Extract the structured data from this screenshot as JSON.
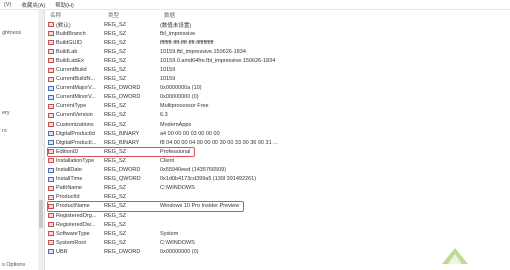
{
  "menubar": {
    "items": [
      "(V)",
      "收藏夹(A)",
      "帮助(H)"
    ]
  },
  "left_pane": {
    "labels": [
      {
        "text": "ghtness"
      },
      {
        "text": "ery"
      },
      {
        "text": "rs"
      },
      {
        "text": "s Options"
      }
    ]
  },
  "header": {
    "name": "名称",
    "type": "类型",
    "data": "数据"
  },
  "rows": [
    {
      "name": "(默认)",
      "type": "REG_SZ",
      "data": "(数值未设置)",
      "icon": "string-value-icon"
    },
    {
      "name": "BuildBranch",
      "type": "REG_SZ",
      "data": "fbl_impressive",
      "icon": "string-value-icon"
    },
    {
      "name": "BuildGUID",
      "type": "REG_SZ",
      "data": "ffffffff-ffff-ffff-ffff-ffffffffffff",
      "icon": "string-value-icon"
    },
    {
      "name": "BuildLab",
      "type": "REG_SZ",
      "data": "10159.fbl_impressive.150626-1834",
      "icon": "string-value-icon"
    },
    {
      "name": "BuildLabEx",
      "type": "REG_SZ",
      "data": "10159.0.amd64fre.fbl_impressive.150626-1834",
      "icon": "string-value-icon"
    },
    {
      "name": "CurrentBuild",
      "type": "REG_SZ",
      "data": "10159",
      "icon": "string-value-icon"
    },
    {
      "name": "CurrentBuildN...",
      "type": "REG_SZ",
      "data": "10159",
      "icon": "string-value-icon"
    },
    {
      "name": "CurrentMajorV...",
      "type": "REG_DWORD",
      "data": "0x0000000a (10)",
      "icon": "binary-value-icon"
    },
    {
      "name": "CurrentMinorV...",
      "type": "REG_DWORD",
      "data": "0x00000000 (0)",
      "icon": "binary-value-icon"
    },
    {
      "name": "CurrentType",
      "type": "REG_SZ",
      "data": "Multiprocessor Free",
      "icon": "string-value-icon"
    },
    {
      "name": "CurrentVersion",
      "type": "REG_SZ",
      "data": "6.3",
      "icon": "string-value-icon"
    },
    {
      "name": "Customizations",
      "type": "REG_SZ",
      "data": "ModernApps",
      "icon": "string-value-icon"
    },
    {
      "name": "DigitalProductId",
      "type": "REG_BINARY",
      "data": "a4 00 00 00 03 00 00 00",
      "icon": "binary-value-icon"
    },
    {
      "name": "DigitalProductI...",
      "type": "REG_BINARY",
      "data": "f8 04 00 00 04 00 00 00 30 00 33 00 36 00 31 ...",
      "icon": "binary-value-icon"
    },
    {
      "name": "EditionID",
      "type": "REG_SZ",
      "data": "Professional",
      "icon": "string-value-icon"
    },
    {
      "name": "InstallationType",
      "type": "REG_SZ",
      "data": "Client",
      "icon": "string-value-icon"
    },
    {
      "name": "InstallDate",
      "type": "REG_DWORD",
      "data": "0x55940eed (1435766509)",
      "icon": "binary-value-icon"
    },
    {
      "name": "InstallTime",
      "type": "REG_QWORD",
      "data": "0x1d0b4173cd399a5 (130l          391492261)",
      "icon": "binary-value-icon"
    },
    {
      "name": "PathName",
      "type": "REG_SZ",
      "data": "C:\\WINDOWS",
      "icon": "string-value-icon"
    },
    {
      "name": "ProductId",
      "type": "REG_SZ",
      "data": "",
      "icon": "string-value-icon"
    },
    {
      "name": "ProductName",
      "type": "REG_SZ",
      "data": "Windows 10 Pro Insider Preview",
      "icon": "string-value-icon"
    },
    {
      "name": "RegisteredOrg...",
      "type": "REG_SZ",
      "data": "",
      "icon": "string-value-icon"
    },
    {
      "name": "RegisteredOw...",
      "type": "REG_SZ",
      "data": "",
      "icon": "string-value-icon"
    },
    {
      "name": "SoftwareType",
      "type": "REG_SZ",
      "data": "System",
      "icon": "string-value-icon"
    },
    {
      "name": "SystemRoot",
      "type": "REG_SZ",
      "data": "C:\\WINDOWS",
      "icon": "string-value-icon"
    },
    {
      "name": "UBR",
      "type": "REG_DWORD",
      "data": "0x00000000 (0)",
      "icon": "binary-value-icon"
    }
  ],
  "colors": {
    "highlight": "#d9534f",
    "string_icon": "#c45050",
    "binary_icon": "#4a6fb5"
  }
}
